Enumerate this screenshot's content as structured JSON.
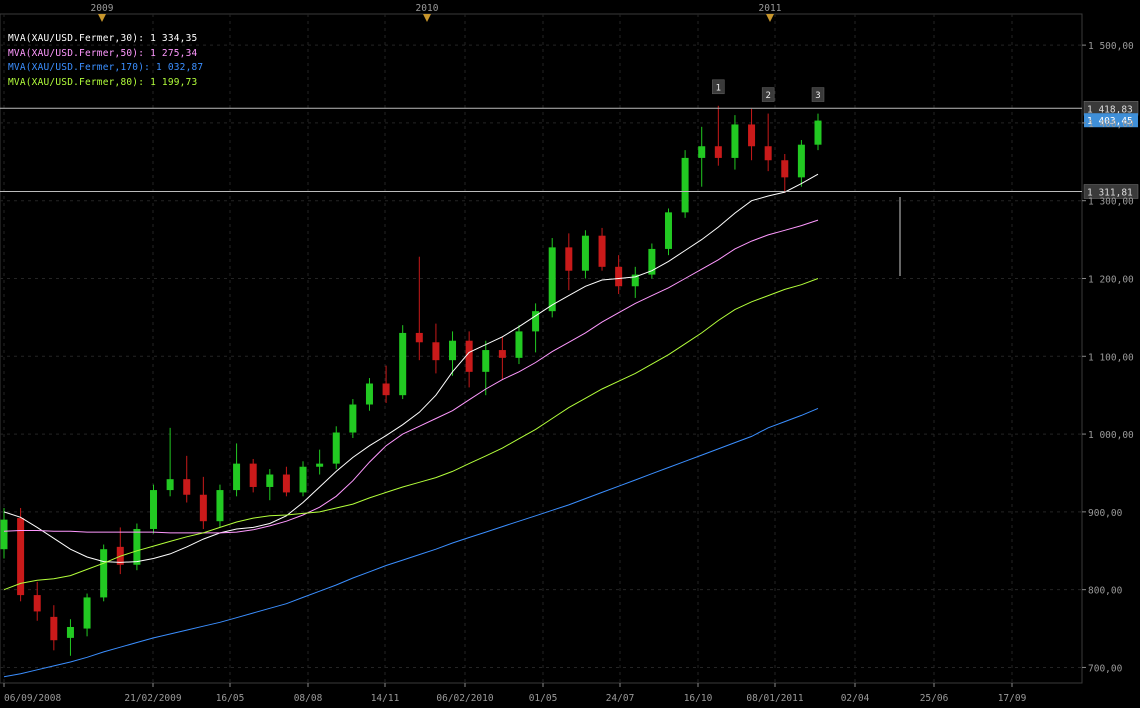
{
  "chart_data": {
    "type": "candlestick",
    "instrument": "XAU/USD",
    "ylim": [
      680,
      1540
    ],
    "year_markers": [
      "2009",
      "2010",
      "2011"
    ],
    "y_ticks": [
      "700,00",
      "800,00",
      "900,00",
      "1 000,00",
      "1 100,00",
      "1 200,00",
      "1 300,00",
      "1 400,00",
      "1 500,00"
    ],
    "x_ticks": [
      "06/09/2008",
      "21/02/2009",
      "16/05",
      "08/08",
      "14/11",
      "06/02/2010",
      "01/05",
      "24/07",
      "16/10",
      "08/01/2011",
      "02/04",
      "25/06",
      "17/09"
    ],
    "moving_averages": [
      {
        "label": "MVA(XAU/USD.Fermer,30)",
        "value": "1 334,35",
        "color": "#ffffff",
        "values": [
          900,
          893,
          880,
          866,
          852,
          842,
          836,
          835,
          836,
          840,
          846,
          855,
          865,
          873,
          878,
          880,
          885,
          895,
          912,
          932,
          952,
          970,
          985,
          998,
          1012,
          1028,
          1050,
          1080,
          1105,
          1115,
          1125,
          1138,
          1152,
          1166,
          1178,
          1190,
          1198,
          1200,
          1202,
          1210,
          1222,
          1236,
          1250,
          1266,
          1284,
          1300,
          1306,
          1311,
          1322,
          1334
        ]
      },
      {
        "label": "MVA(XAU/USD.Fermer,50)",
        "value": "1 275,34",
        "color": "#ff99ff",
        "values": [
          875,
          876,
          876,
          875,
          875,
          874,
          874,
          874,
          874,
          874,
          873,
          873,
          873,
          873,
          874,
          877,
          882,
          888,
          896,
          906,
          920,
          940,
          964,
          985,
          1000,
          1010,
          1020,
          1030,
          1044,
          1058,
          1070,
          1080,
          1092,
          1106,
          1118,
          1130,
          1144,
          1156,
          1168,
          1178,
          1188,
          1200,
          1212,
          1224,
          1238,
          1248,
          1256,
          1262,
          1268,
          1275
        ]
      },
      {
        "label": "MVA(XAU/USD.Fermer,170)",
        "value": "1 032,87",
        "color": "#3b8fff",
        "values": [
          688,
          692,
          697,
          702,
          707,
          713,
          720,
          726,
          732,
          738,
          743,
          748,
          753,
          758,
          764,
          770,
          776,
          782,
          790,
          798,
          806,
          815,
          823,
          831,
          838,
          845,
          852,
          860,
          867,
          874,
          881,
          888,
          895,
          902,
          909,
          917,
          925,
          933,
          941,
          949,
          957,
          965,
          973,
          981,
          989,
          997,
          1008,
          1016,
          1024,
          1033
        ]
      },
      {
        "label": "MVA(XAU/USD.Fermer,80)",
        "value": "1 199,73",
        "color": "#b3ff3b",
        "values": [
          800,
          808,
          812,
          814,
          818,
          826,
          834,
          843,
          850,
          856,
          862,
          868,
          873,
          880,
          887,
          892,
          895,
          896,
          898,
          900,
          905,
          910,
          918,
          925,
          932,
          938,
          944,
          952,
          962,
          972,
          982,
          994,
          1006,
          1020,
          1034,
          1046,
          1058,
          1068,
          1078,
          1090,
          1102,
          1116,
          1130,
          1146,
          1160,
          1170,
          1178,
          1186,
          1192,
          1200
        ]
      }
    ],
    "price_labels": [
      {
        "value": "1 418,83",
        "style": "line"
      },
      {
        "value": "1 403,45",
        "style": "current"
      },
      {
        "value": "1 311,81",
        "style": "line"
      }
    ],
    "markers": [
      "1",
      "2",
      "3"
    ],
    "candles": [
      {
        "o": 852,
        "h": 905,
        "l": 840,
        "c": 890
      },
      {
        "o": 892,
        "h": 905,
        "l": 785,
        "c": 793
      },
      {
        "o": 793,
        "h": 810,
        "l": 760,
        "c": 772
      },
      {
        "o": 765,
        "h": 780,
        "l": 722,
        "c": 735
      },
      {
        "o": 738,
        "h": 762,
        "l": 715,
        "c": 752
      },
      {
        "o": 750,
        "h": 795,
        "l": 740,
        "c": 790
      },
      {
        "o": 790,
        "h": 858,
        "l": 785,
        "c": 852
      },
      {
        "o": 855,
        "h": 880,
        "l": 820,
        "c": 832
      },
      {
        "o": 832,
        "h": 885,
        "l": 825,
        "c": 878
      },
      {
        "o": 878,
        "h": 935,
        "l": 872,
        "c": 928
      },
      {
        "o": 928,
        "h": 1008,
        "l": 920,
        "c": 942
      },
      {
        "o": 942,
        "h": 972,
        "l": 912,
        "c": 922
      },
      {
        "o": 922,
        "h": 945,
        "l": 878,
        "c": 888
      },
      {
        "o": 888,
        "h": 935,
        "l": 880,
        "c": 928
      },
      {
        "o": 928,
        "h": 988,
        "l": 920,
        "c": 962
      },
      {
        "o": 962,
        "h": 968,
        "l": 925,
        "c": 932
      },
      {
        "o": 932,
        "h": 955,
        "l": 915,
        "c": 948
      },
      {
        "o": 948,
        "h": 958,
        "l": 920,
        "c": 925
      },
      {
        "o": 925,
        "h": 965,
        "l": 920,
        "c": 958
      },
      {
        "o": 958,
        "h": 980,
        "l": 948,
        "c": 962
      },
      {
        "o": 962,
        "h": 1010,
        "l": 955,
        "c": 1002
      },
      {
        "o": 1002,
        "h": 1045,
        "l": 995,
        "c": 1038
      },
      {
        "o": 1038,
        "h": 1072,
        "l": 1030,
        "c": 1065
      },
      {
        "o": 1065,
        "h": 1088,
        "l": 1040,
        "c": 1050
      },
      {
        "o": 1050,
        "h": 1140,
        "l": 1045,
        "c": 1130
      },
      {
        "o": 1130,
        "h": 1228,
        "l": 1095,
        "c": 1118
      },
      {
        "o": 1118,
        "h": 1142,
        "l": 1078,
        "c": 1095
      },
      {
        "o": 1095,
        "h": 1132,
        "l": 1075,
        "c": 1120
      },
      {
        "o": 1120,
        "h": 1132,
        "l": 1060,
        "c": 1080
      },
      {
        "o": 1080,
        "h": 1120,
        "l": 1050,
        "c": 1108
      },
      {
        "o": 1108,
        "h": 1125,
        "l": 1070,
        "c": 1098
      },
      {
        "o": 1098,
        "h": 1140,
        "l": 1090,
        "c": 1132
      },
      {
        "o": 1132,
        "h": 1168,
        "l": 1105,
        "c": 1158
      },
      {
        "o": 1158,
        "h": 1252,
        "l": 1150,
        "c": 1240
      },
      {
        "o": 1240,
        "h": 1258,
        "l": 1185,
        "c": 1210
      },
      {
        "o": 1210,
        "h": 1262,
        "l": 1200,
        "c": 1255
      },
      {
        "o": 1255,
        "h": 1265,
        "l": 1210,
        "c": 1215
      },
      {
        "o": 1215,
        "h": 1230,
        "l": 1180,
        "c": 1190
      },
      {
        "o": 1190,
        "h": 1215,
        "l": 1175,
        "c": 1205
      },
      {
        "o": 1205,
        "h": 1245,
        "l": 1200,
        "c": 1238
      },
      {
        "o": 1238,
        "h": 1290,
        "l": 1230,
        "c": 1285
      },
      {
        "o": 1285,
        "h": 1365,
        "l": 1278,
        "c": 1355
      },
      {
        "o": 1355,
        "h": 1395,
        "l": 1318,
        "c": 1370
      },
      {
        "o": 1370,
        "h": 1422,
        "l": 1345,
        "c": 1355
      },
      {
        "o": 1355,
        "h": 1410,
        "l": 1340,
        "c": 1398
      },
      {
        "o": 1398,
        "h": 1418,
        "l": 1352,
        "c": 1370
      },
      {
        "o": 1370,
        "h": 1412,
        "l": 1338,
        "c": 1352
      },
      {
        "o": 1352,
        "h": 1360,
        "l": 1310,
        "c": 1330
      },
      {
        "o": 1330,
        "h": 1378,
        "l": 1318,
        "c": 1372
      },
      {
        "o": 1372,
        "h": 1412,
        "l": 1365,
        "c": 1403
      }
    ]
  }
}
